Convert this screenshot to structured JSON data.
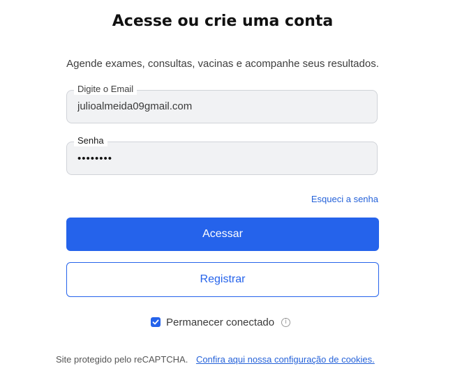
{
  "header": {
    "title": "Acesse ou crie uma conta",
    "subtitle": "Agende exames, consultas, vacinas e acompanhe seus resultados."
  },
  "form": {
    "email_label": "Digite o Email",
    "email_value": "julioalmeida09gmail.com",
    "password_label": "Senha",
    "password_value": "••••••••",
    "forgot_password": "Esqueci a senha",
    "submit_label": "Acessar",
    "register_label": "Registrar",
    "remember_label": "Permanecer conectado",
    "remember_checked": true
  },
  "footer": {
    "recaptcha_text": "Site protegido pelo reCAPTCHA.",
    "cookies_link": "Confira aqui nossa configuração de cookies."
  },
  "colors": {
    "accent": "#2563eb",
    "field_bg": "#f1f2f4"
  },
  "icons": {
    "checkbox": "checkmark-icon",
    "info": "info-icon"
  }
}
